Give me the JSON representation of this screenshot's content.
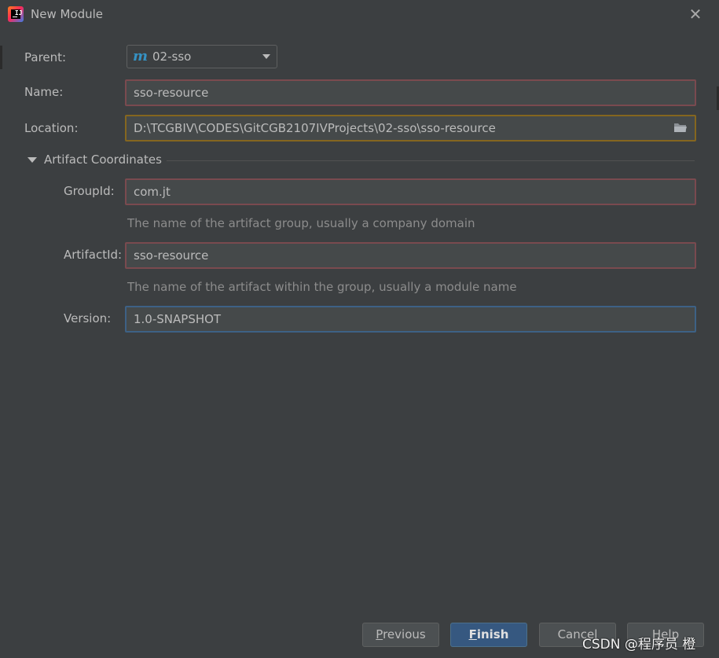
{
  "window": {
    "title": "New Module"
  },
  "form": {
    "parent": {
      "label": "Parent:",
      "value": "02-sso",
      "icon": "maven-icon"
    },
    "name": {
      "label": "Name:",
      "value": "sso-resource"
    },
    "location": {
      "label": "Location:",
      "value": "D:\\TCGBIV\\CODES\\GitCGB2107IVProjects\\02-sso\\sso-resource",
      "icon": "folder-icon"
    }
  },
  "artifact": {
    "section_label": "Artifact Coordinates",
    "group_id": {
      "label": "GroupId:",
      "value": "com.jt",
      "hint": "The name of the artifact group, usually a company domain"
    },
    "artifact_id": {
      "label": "ArtifactId:",
      "value": "sso-resource",
      "hint": "The name of the artifact within the group, usually a module name"
    },
    "version": {
      "label": "Version:",
      "value": "1.0-SNAPSHOT"
    }
  },
  "buttons": {
    "previous": {
      "mnemonic": "P",
      "rest": "revious"
    },
    "finish": {
      "mnemonic": "F",
      "rest": "inish"
    },
    "cancel": "Cancel",
    "help": "Help"
  },
  "watermark": "CSDN @程序员 橙",
  "colors": {
    "background": "#3c3f41",
    "field_background": "#45494a",
    "field_border_error": "#7a4a4f",
    "field_border_warning": "#85661f",
    "field_border_focus": "#3d6185",
    "primary_button": "#365880"
  }
}
